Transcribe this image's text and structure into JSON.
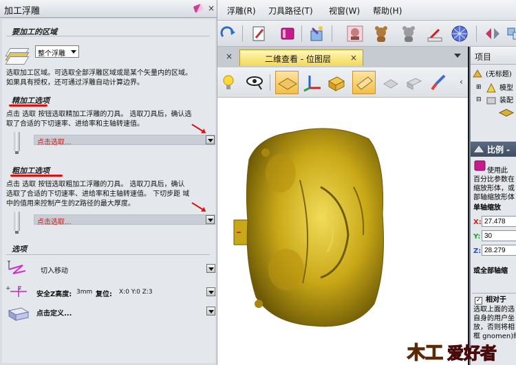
{
  "left_panel": {
    "title": "加工浮雕",
    "section_region": {
      "heading": "要加工的区域",
      "combo_value": "整个浮雕",
      "description": [
        "选取加工区域。可选取全部浮雕区域或是某个矢量内的区域。",
        "如果具有授权，还可通过浮雕自动计算边界。"
      ]
    },
    "section_finish": {
      "heading": "精加工选项",
      "description": [
        "点击 选取 按钮选取精加工浮雕的刀具。 选取刀具后，确认选",
        "取了合适的下切速率、进给率和主轴转速值。"
      ],
      "select_label": "点击选取..."
    },
    "section_rough": {
      "heading": "粗加工选项",
      "description": [
        "点击 选取 按钮选取粗加工浮雕的刀具。  选取刀具后，确认",
        "选取了合适的下切速率、进给率和主轴转速值。 下切步距 域",
        "中的值用来控制产生的Z路径的最大厚度。"
      ],
      "select_label": "点击选取..."
    },
    "section_options": {
      "heading": "选项",
      "plunge_label": "切入移动",
      "safe_z_label": "安全Z高度:",
      "safe_z_value": "3mm",
      "home_label": "复位:",
      "home_value": "X:0 Y:0 Z:3",
      "define_label": "点击定义..."
    }
  },
  "menu": {
    "items": [
      "浮雕(R)",
      "刀具路径(T)",
      "视窗(W)",
      "帮助(H)"
    ]
  },
  "view": {
    "close_glyph": "×",
    "active_tab": "二维查看 - 位图层",
    "tab_close": "×"
  },
  "right_panel": {
    "title": "项目",
    "tree": {
      "root": "(无标题)",
      "model": "模型",
      "assembly": "装配"
    },
    "scale_title": "比例 -",
    "desc_lines": [
      "使用此",
      "百分比参数在",
      "缩放形体，或",
      "部轴缩放形体"
    ],
    "single_axis": "单轴缩放",
    "x_label": "X:",
    "x_value": "27.478",
    "y_label": "Y:",
    "y_value": "30",
    "z_label": "Z:",
    "z_value": "28.279",
    "all_axis": "或全部轴缩",
    "relative_label": "相对于",
    "bottom_lines": [
      "选取上面的选",
      "自身的用户坐",
      "放，否则将相",
      "框 gnomen)缩"
    ]
  },
  "watermark": {
    "text": "木工爱好者"
  },
  "colors": {
    "accent_red": "#e01010",
    "relief_gold": "#c9a817",
    "tab_yellow": "#f2d95a",
    "panel_bg": "#e4e7eb"
  }
}
